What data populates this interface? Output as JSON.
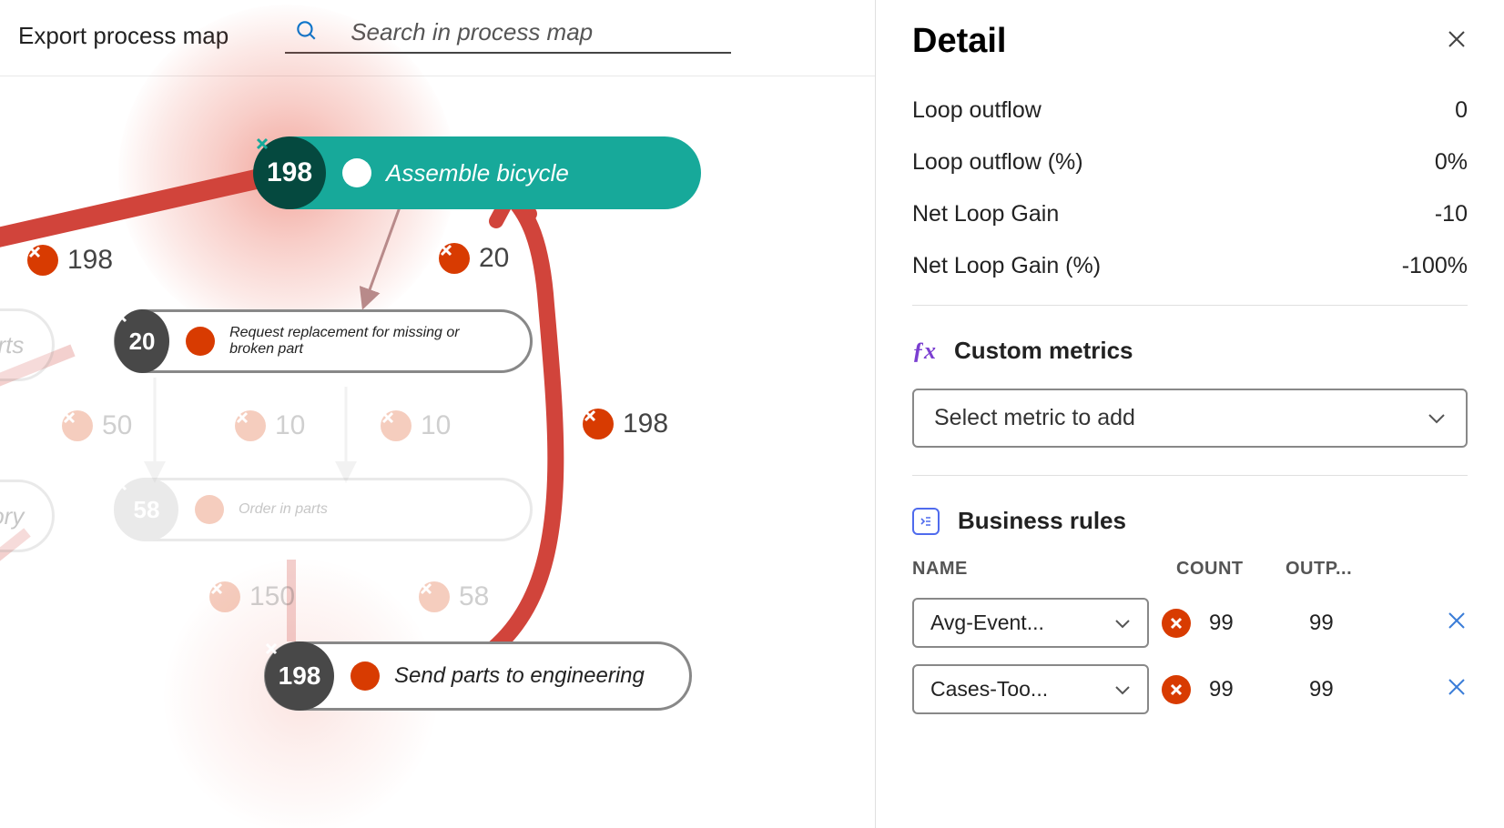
{
  "header": {
    "export_label": "Export process map",
    "search_placeholder": "Search in process map"
  },
  "nodes": {
    "assemble": {
      "count": "198",
      "label": "Assemble bicycle"
    },
    "request_replacement": {
      "count": "20",
      "label": "Request replacement for missing or broken part"
    },
    "order_parts": {
      "count": "58",
      "label": "Order in parts"
    },
    "send_engineering": {
      "count": "198",
      "label": "Send parts to engineering"
    },
    "partial_arts": {
      "label": "arts"
    },
    "partial_tory": {
      "label": "tory"
    }
  },
  "edge_labels": {
    "e198a": "198",
    "e20": "20",
    "e198b": "198",
    "e50": "50",
    "e10a": "10",
    "e10b": "10",
    "e150": "150",
    "e58": "58"
  },
  "detail": {
    "title": "Detail",
    "metrics": [
      {
        "label": "Loop outflow",
        "value": "0"
      },
      {
        "label": "Loop outflow (%)",
        "value": "0%"
      },
      {
        "label": "Net Loop Gain",
        "value": "-10"
      },
      {
        "label": "Net Loop Gain (%)",
        "value": "-100%"
      }
    ],
    "custom_metrics_title": "Custom metrics",
    "select_metric_placeholder": "Select metric to add",
    "business_rules_title": "Business rules",
    "rules_columns": {
      "name": "NAME",
      "count": "COUNT",
      "output": "OUTP..."
    },
    "rules": [
      {
        "name": "Avg-Event...",
        "count": "99",
        "output": "99"
      },
      {
        "name": "Cases-Too...",
        "count": "99",
        "output": "99"
      }
    ]
  }
}
